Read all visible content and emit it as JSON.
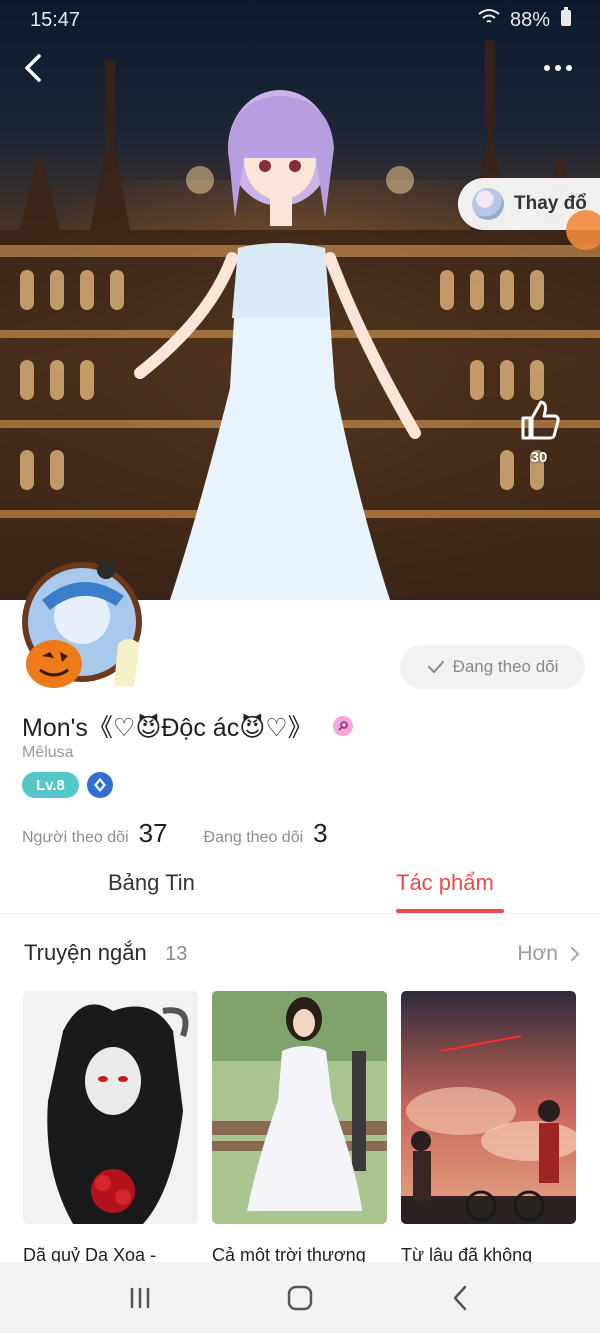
{
  "status_bar": {
    "time": "15:47",
    "battery": "88%"
  },
  "hero": {
    "change_label": "Thay đổ",
    "like_count": "30"
  },
  "profile": {
    "name": "Mon's《♡😈Độc ác😈♡》",
    "subname": "Mêlusa",
    "level": "Lv.8",
    "follow_button": "Đang theo dõi",
    "stats": {
      "followers_label": "Người theo dõi",
      "followers_count": "37",
      "following_label": "Đang theo dõi",
      "following_count": "3"
    }
  },
  "tabs": [
    {
      "label": "Bảng Tin",
      "active": false
    },
    {
      "label": "Tác phẩm",
      "active": true
    }
  ],
  "section": {
    "title": "Truyện ngắn",
    "count": "13",
    "more_label": "Hơn"
  },
  "stories": [
    {
      "title": "Dã quỷ Dạ Xoa -"
    },
    {
      "title": "Cả một trời thương"
    },
    {
      "title": "Từ lâu đã không"
    }
  ],
  "colors": {
    "accent": "#e84b4b",
    "level_badge": "#54c7c9",
    "gem": "#2f6fd1"
  },
  "icons": [
    "back-icon",
    "more-icon",
    "camera-icon",
    "thumbs-up-icon",
    "check-icon",
    "search-badge-icon",
    "gem-icon",
    "chevron-right-icon",
    "recents-icon",
    "home-icon",
    "nav-back-icon"
  ]
}
